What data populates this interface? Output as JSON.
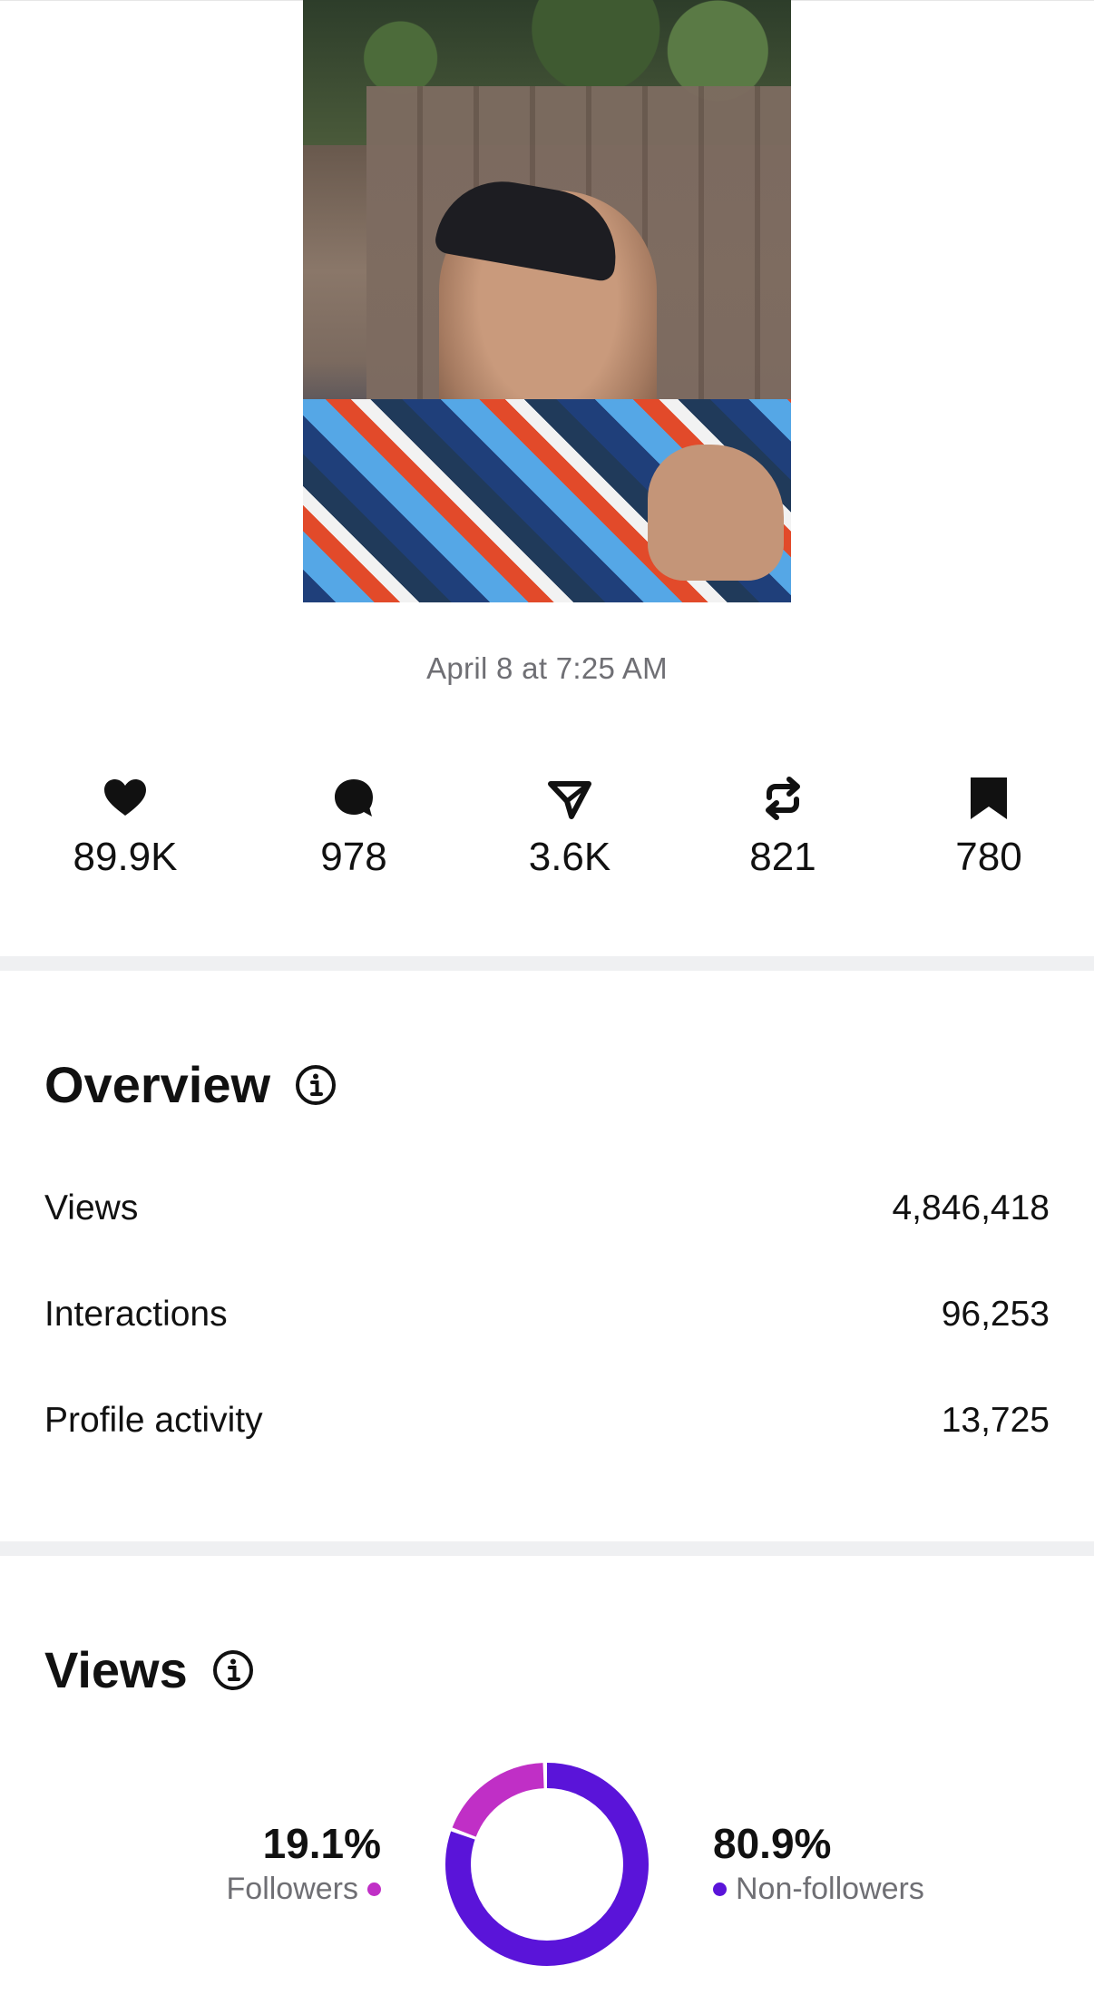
{
  "post": {
    "timestamp": "April 8 at 7:25 AM"
  },
  "stats": [
    {
      "icon": "heart-icon",
      "value": "89.9K"
    },
    {
      "icon": "comment-icon",
      "value": "978"
    },
    {
      "icon": "share-icon",
      "value": "3.6K"
    },
    {
      "icon": "repost-icon",
      "value": "821"
    },
    {
      "icon": "bookmark-icon",
      "value": "780"
    }
  ],
  "overview": {
    "title": "Overview",
    "rows": [
      {
        "label": "Views",
        "value": "4,846,418"
      },
      {
        "label": "Interactions",
        "value": "96,253"
      },
      {
        "label": "Profile activity",
        "value": "13,725"
      }
    ]
  },
  "views": {
    "title": "Views",
    "followers": {
      "percent": "19.1%",
      "label": "Followers",
      "fraction": 0.191,
      "color": "#c02fc6"
    },
    "non_followers": {
      "percent": "80.9%",
      "label": "Non-followers",
      "fraction": 0.809,
      "color": "#5a14d9"
    }
  }
}
